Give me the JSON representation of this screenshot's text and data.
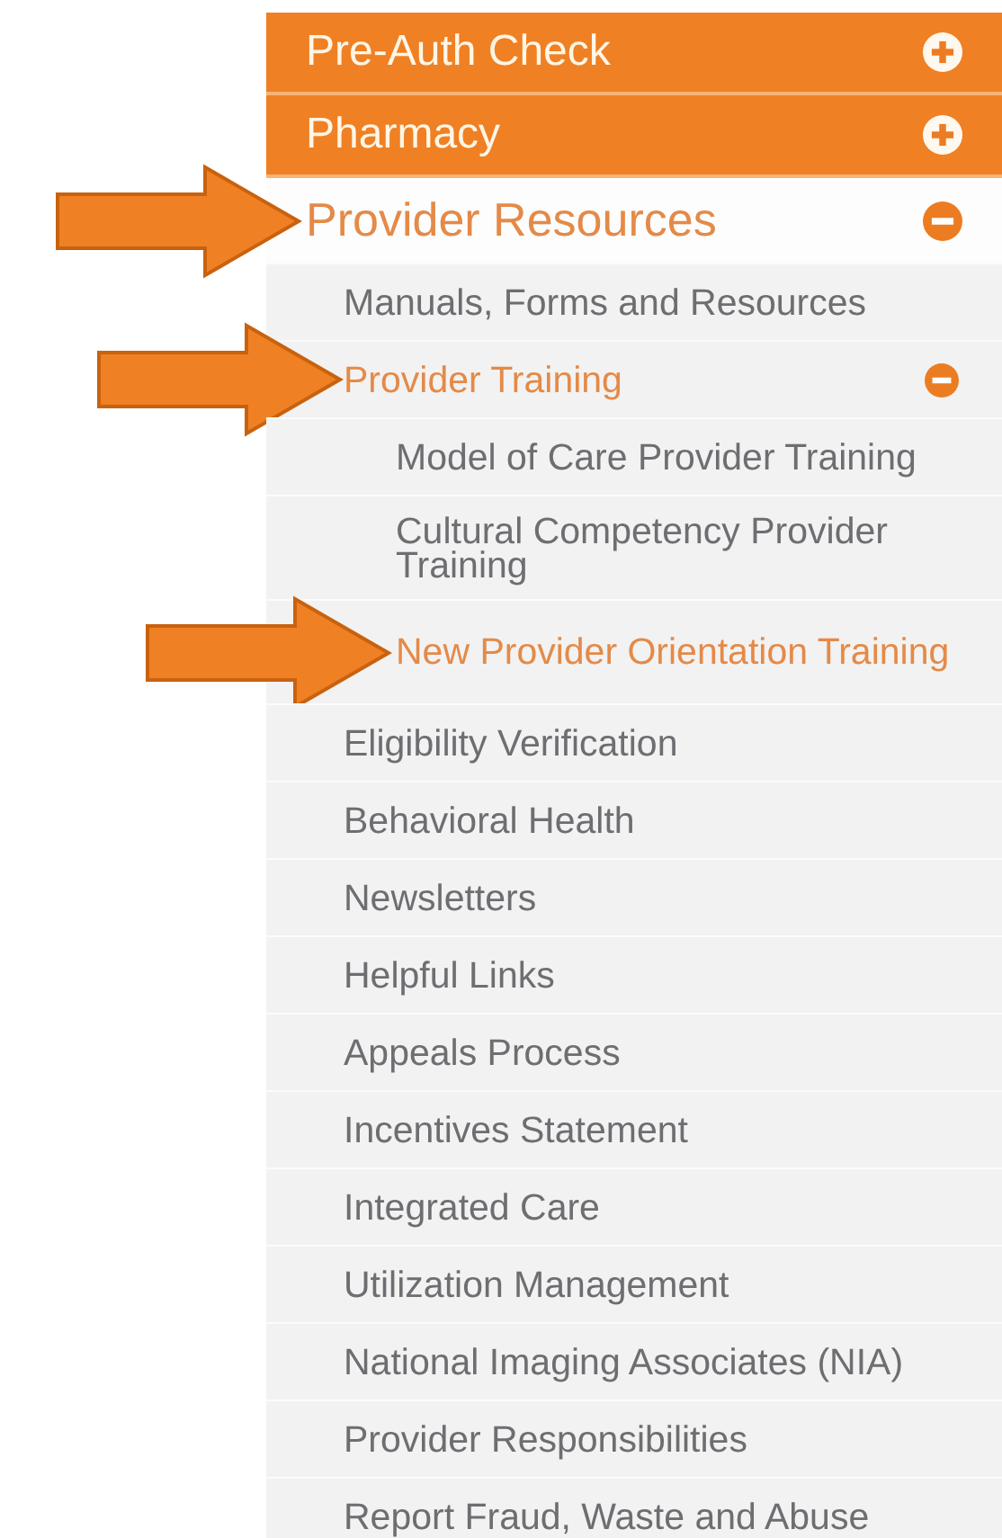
{
  "menu": [
    {
      "label": "Pre-Auth Check",
      "selected": false,
      "expanded": false,
      "pointed": false
    },
    {
      "label": "Pharmacy",
      "selected": false,
      "expanded": false,
      "pointed": false
    },
    {
      "label": "Provider Resources",
      "selected": true,
      "expanded": true,
      "pointed": true,
      "children": [
        {
          "label": "Manuals, Forms and Resources",
          "selected": false,
          "pointed": false
        },
        {
          "label": "Provider Training",
          "selected": true,
          "expanded": true,
          "pointed": true,
          "children": [
            {
              "label": "Model of Care Provider Training",
              "selected": false,
              "pointed": false
            },
            {
              "label": "Cultural Competency Provider Training",
              "selected": false,
              "pointed": false
            },
            {
              "label": "New Provider Orientation Training",
              "selected": true,
              "pointed": true
            }
          ]
        },
        {
          "label": "Eligibility Verification",
          "selected": false,
          "pointed": false
        },
        {
          "label": "Behavioral Health",
          "selected": false,
          "pointed": false
        },
        {
          "label": "Newsletters",
          "selected": false,
          "pointed": false
        },
        {
          "label": "Helpful Links",
          "selected": false,
          "pointed": false
        },
        {
          "label": "Appeals Process",
          "selected": false,
          "pointed": false
        },
        {
          "label": "Incentives Statement",
          "selected": false,
          "pointed": false
        },
        {
          "label": "Integrated Care",
          "selected": false,
          "pointed": false
        },
        {
          "label": "Utilization Management",
          "selected": false,
          "pointed": false
        },
        {
          "label": "National Imaging Associates (NIA)",
          "selected": false,
          "pointed": false
        },
        {
          "label": "Provider Responsibilities",
          "selected": false,
          "pointed": false
        },
        {
          "label": "Report Fraud, Waste and Abuse",
          "selected": false,
          "pointed": false
        }
      ]
    }
  ]
}
